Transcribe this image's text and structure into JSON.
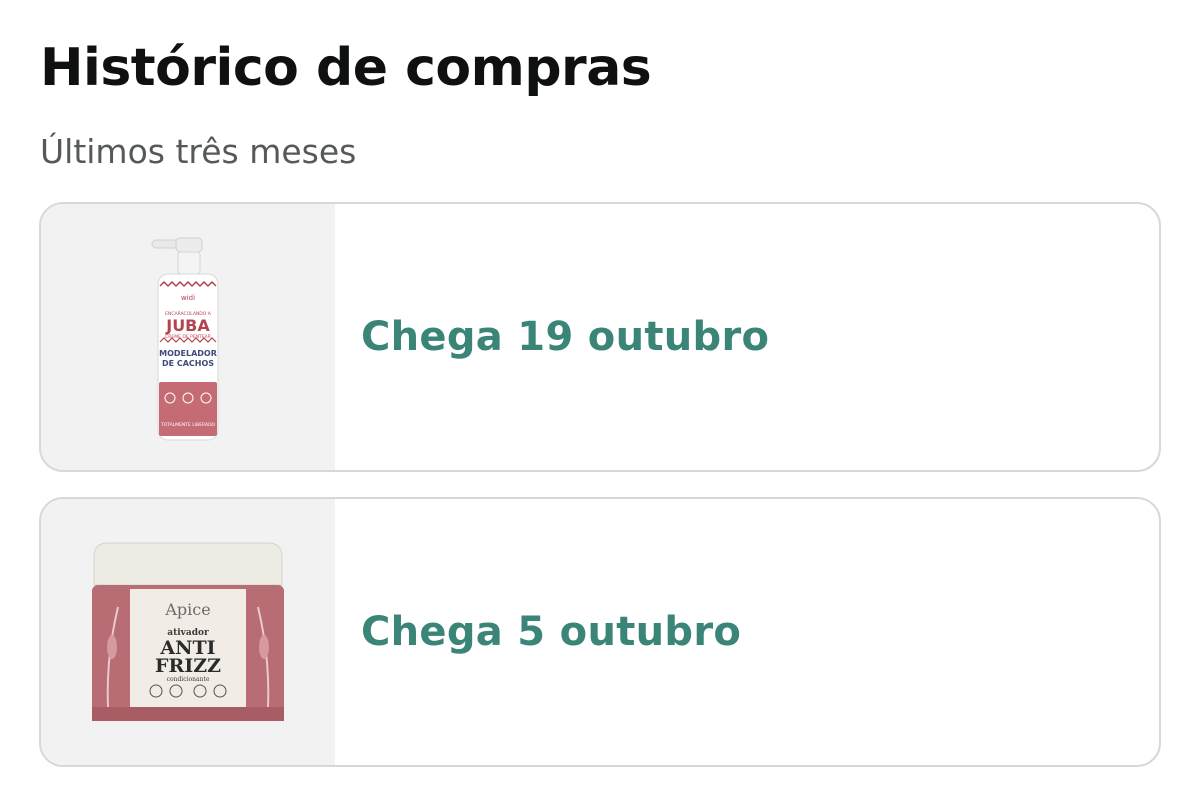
{
  "header": {
    "title": "Histórico de compras",
    "subtitle": "Últimos três meses"
  },
  "colors": {
    "accent_teal": "#3a8577",
    "title_text": "#0f1111",
    "secondary_text": "#565959",
    "card_border": "#d5d9d9",
    "thumb_bg": "#f2f2f3"
  },
  "orders": [
    {
      "arrival": "Chega 19 outubro",
      "product_icon": "hair-cream-pump-bottle",
      "label": {
        "brand": "widi",
        "line": "ENCARACOLANDO A",
        "name": "JUBA",
        "sub": "CREME DE PENTEAR",
        "desc1": "MODELADOR",
        "desc2": "DE CACHOS",
        "footer": "TOTALMENTE LIBERADO"
      }
    },
    {
      "arrival": "Chega 5 outubro",
      "product_icon": "hair-cream-jar",
      "label": {
        "brand": "Apice",
        "line": "ativador",
        "name1": "ANTI",
        "name2": "FRIZZ",
        "sub": "condicionante"
      }
    }
  ]
}
